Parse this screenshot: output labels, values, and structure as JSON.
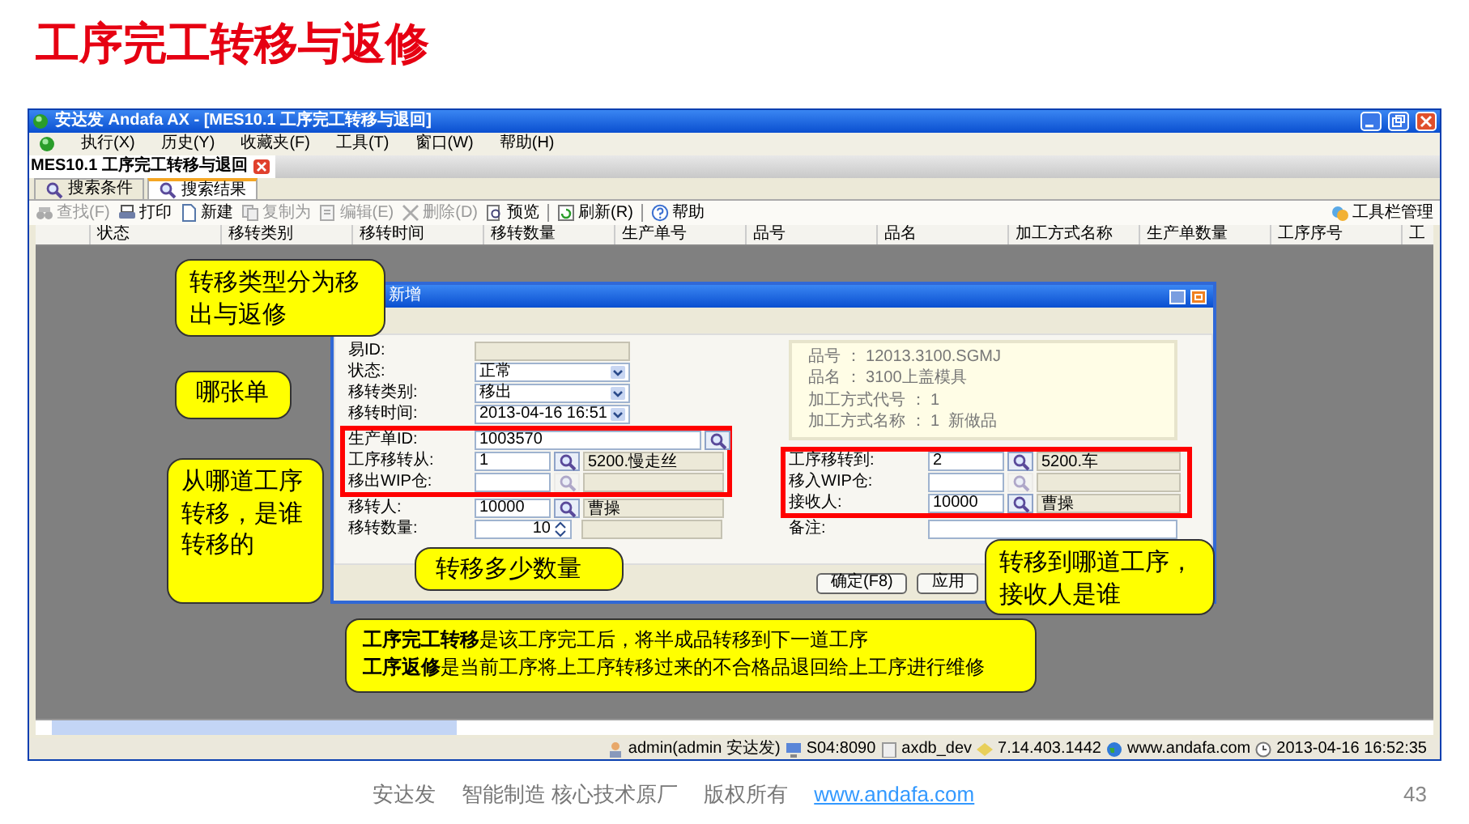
{
  "slide_title": "工序完工转移与返修",
  "window": {
    "title": "安达发 Andafa AX - [MES10.1 工序完工转移与退回]",
    "menu": [
      "执行(X)",
      "历史(Y)",
      "收藏夹(F)",
      "工具(T)",
      "窗口(W)",
      "帮助(H)"
    ],
    "doc_tab": "MES10.1 工序完工转移与退回",
    "view_tabs": [
      {
        "label": "搜索条件",
        "selected": false
      },
      {
        "label": "搜索结果",
        "selected": true
      }
    ],
    "toolbar": [
      {
        "label": "查找(F)",
        "disabled": true
      },
      {
        "label": "打印",
        "disabled": false
      },
      {
        "label": "新建",
        "disabled": false
      },
      {
        "label": "复制为",
        "disabled": true
      },
      {
        "label": "编辑(E)",
        "disabled": true
      },
      {
        "label": "删除(D)",
        "disabled": true
      },
      {
        "label": "预览",
        "disabled": false
      },
      {
        "label": "刷新(R)",
        "disabled": false
      },
      {
        "label": "帮助",
        "disabled": false
      }
    ],
    "toolbar_manage": "工具栏管理",
    "table": {
      "columns": [
        "状态",
        "移转类别",
        "移转时间",
        "移转数量",
        "生产单号",
        "品号",
        "品名",
        "加工方式名称",
        "生产单数量",
        "工序序号",
        "工"
      ]
    },
    "status_bar": [
      "admin(admin 安达发)",
      "S04:8090",
      "axdb_dev",
      "7.14.403.1442",
      "www.andafa.com",
      "2013-04-16 16:52:35"
    ]
  },
  "dialog": {
    "title": "新增",
    "info": [
      "品号 ： 12013.3100.SGMJ",
      "品名 ： 3100上盖模具",
      "加工方式代号 ： 1",
      "加工方式名称 ： 1  新做品"
    ],
    "left_fields": [
      {
        "kind": "readonly",
        "label": "易ID:"
      },
      {
        "kind": "select",
        "label": "状态:",
        "value": "正常"
      },
      {
        "kind": "select",
        "label": "移转类别:",
        "value": "移出"
      },
      {
        "kind": "select",
        "label": "移转时间:",
        "value": "2013-04-16 16:51"
      },
      {
        "kind": "lookup_wide",
        "label": "生产单ID:",
        "value": "1003570",
        "lookup_enabled": true
      },
      {
        "kind": "lookup",
        "label": "工序移转从:",
        "value": "1",
        "lookup_enabled": true,
        "desc": "5200.慢走丝"
      },
      {
        "kind": "lookup",
        "label": "移出WIP仓:",
        "lookup_enabled": false
      },
      {
        "kind": "lookup",
        "label": "移转人:",
        "value": "10000",
        "lookup_enabled": true,
        "desc": "曹操"
      },
      {
        "kind": "spin",
        "label": "移转数量:",
        "value": "10"
      }
    ],
    "right_fields": [
      {
        "kind": "lookup",
        "label": "工序移转到:",
        "value": "2",
        "lookup_enabled": true,
        "desc": "5200.车"
      },
      {
        "kind": "lookup",
        "label": "移入WIP仓:",
        "lookup_enabled": false
      },
      {
        "kind": "lookup",
        "label": "接收人:",
        "value": "10000",
        "lookup_enabled": true,
        "desc": "曹操"
      },
      {
        "kind": "text",
        "label": "备注:"
      }
    ],
    "buttons": [
      "确定(F8)",
      "应用"
    ]
  },
  "callouts": [
    "转移类型分为移出与返修",
    "哪张单",
    "从哪道工序转移，是谁转移的",
    "转移多少数量",
    "转移到哪道工序，接收人是谁"
  ],
  "note": [
    "**工序完工转移**是该工序完工后，将半成品转移到下一道工序",
    "**工序返修**是当前工序将上工序转移过来的不合格品退回给上工序进行维修"
  ],
  "footer": {
    "parts": [
      "安达发",
      "智能制造 核心技术原厂",
      "版权所有"
    ],
    "link": "www.andafa.com",
    "page": "43"
  }
}
